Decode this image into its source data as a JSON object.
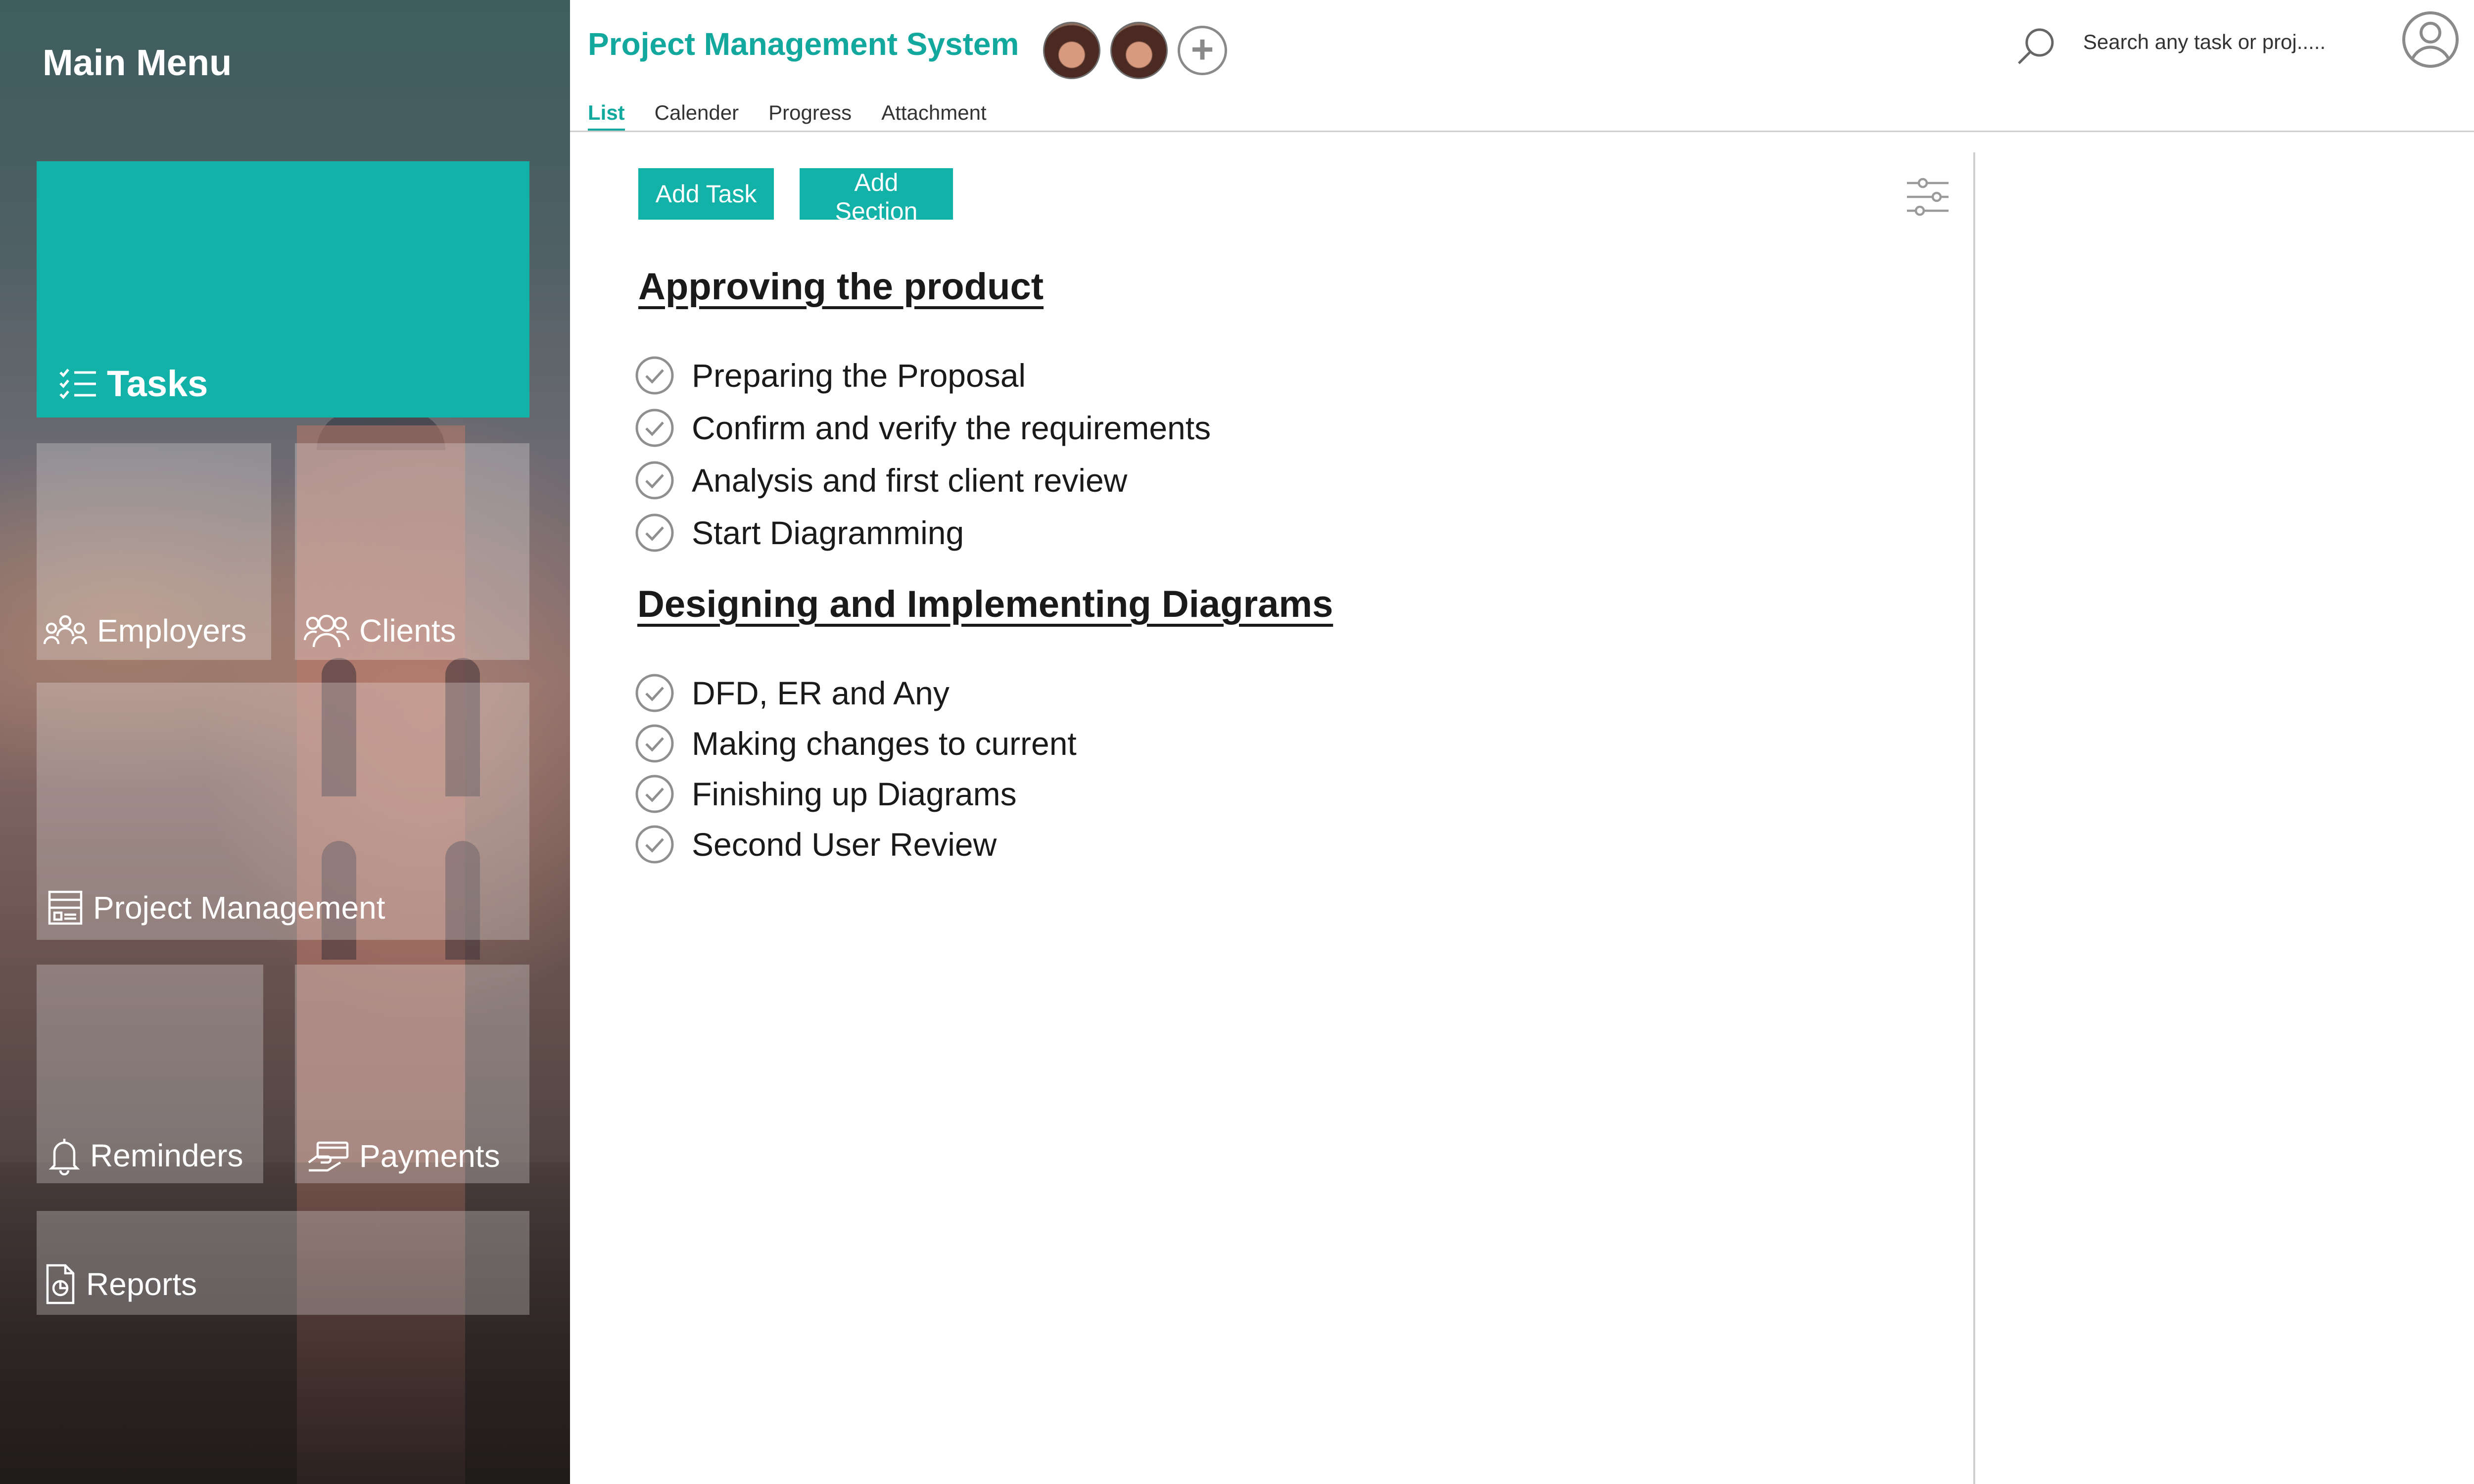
{
  "sidebar": {
    "title": "Main Menu",
    "tiles": {
      "tasks": "Tasks",
      "employers": "Employers",
      "clients": "Clients",
      "project_management": "Project Management",
      "reminders": "Reminders",
      "payments": "Payments",
      "reports": "Reports"
    }
  },
  "header": {
    "title": "Project Management System",
    "search_placeholder": "Search any task or proj.....",
    "tabs": [
      "List",
      "Calender",
      "Progress",
      "Attachment"
    ],
    "active_tab": "List"
  },
  "toolbar": {
    "add_task_label": "Add Task",
    "add_section_label": "Add Section"
  },
  "sections": [
    {
      "title": "Approving the product",
      "tasks": [
        "Preparing the Proposal",
        "Confirm and verify the requirements",
        "Analysis and first client review",
        "Start Diagramming"
      ]
    },
    {
      "title": "Designing and Implementing Diagrams",
      "tasks": [
        "DFD, ER and Any",
        "Making changes to current",
        "Finishing up Diagrams",
        "Second User Review"
      ]
    }
  ],
  "colors": {
    "accent": "#12b2a8",
    "title_text": "#12a89e"
  },
  "icons": [
    "tasks-icon",
    "employers-icon",
    "clients-icon",
    "project-management-icon",
    "reminders-icon",
    "payments-icon",
    "reports-icon",
    "search-icon",
    "user-profile-icon",
    "filter-settings-icon",
    "check-circle-icon",
    "add-member-icon"
  ]
}
